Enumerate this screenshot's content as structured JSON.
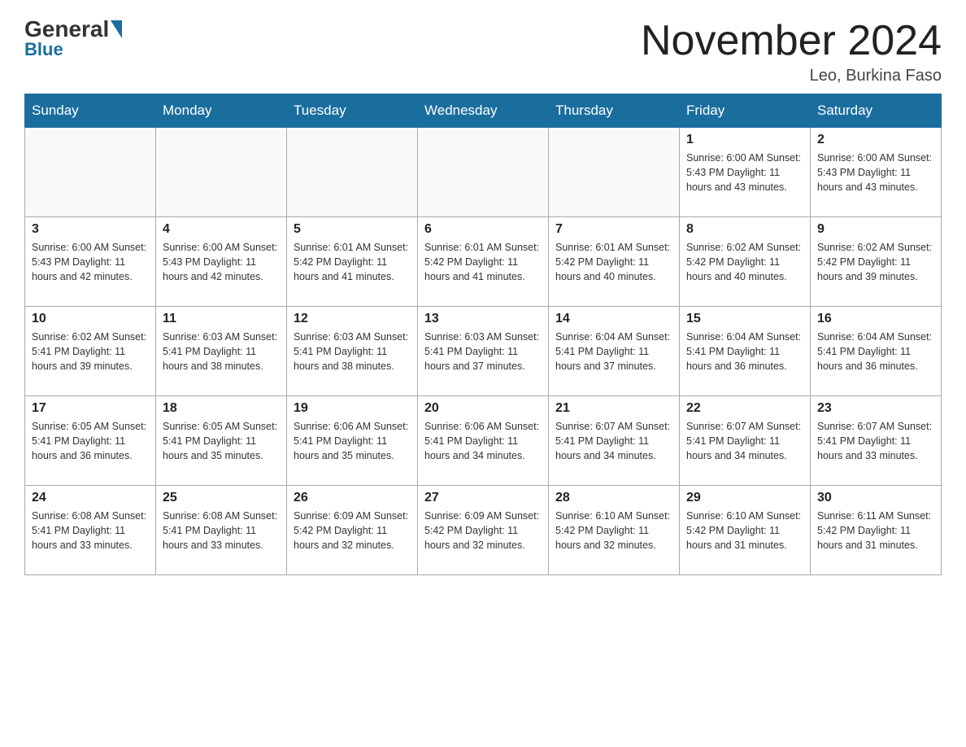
{
  "header": {
    "logo_general": "General",
    "logo_blue": "Blue",
    "month_title": "November 2024",
    "location": "Leo, Burkina Faso"
  },
  "days_of_week": [
    "Sunday",
    "Monday",
    "Tuesday",
    "Wednesday",
    "Thursday",
    "Friday",
    "Saturday"
  ],
  "weeks": [
    [
      {
        "day": "",
        "info": ""
      },
      {
        "day": "",
        "info": ""
      },
      {
        "day": "",
        "info": ""
      },
      {
        "day": "",
        "info": ""
      },
      {
        "day": "",
        "info": ""
      },
      {
        "day": "1",
        "info": "Sunrise: 6:00 AM\nSunset: 5:43 PM\nDaylight: 11 hours and 43 minutes."
      },
      {
        "day": "2",
        "info": "Sunrise: 6:00 AM\nSunset: 5:43 PM\nDaylight: 11 hours and 43 minutes."
      }
    ],
    [
      {
        "day": "3",
        "info": "Sunrise: 6:00 AM\nSunset: 5:43 PM\nDaylight: 11 hours and 42 minutes."
      },
      {
        "day": "4",
        "info": "Sunrise: 6:00 AM\nSunset: 5:43 PM\nDaylight: 11 hours and 42 minutes."
      },
      {
        "day": "5",
        "info": "Sunrise: 6:01 AM\nSunset: 5:42 PM\nDaylight: 11 hours and 41 minutes."
      },
      {
        "day": "6",
        "info": "Sunrise: 6:01 AM\nSunset: 5:42 PM\nDaylight: 11 hours and 41 minutes."
      },
      {
        "day": "7",
        "info": "Sunrise: 6:01 AM\nSunset: 5:42 PM\nDaylight: 11 hours and 40 minutes."
      },
      {
        "day": "8",
        "info": "Sunrise: 6:02 AM\nSunset: 5:42 PM\nDaylight: 11 hours and 40 minutes."
      },
      {
        "day": "9",
        "info": "Sunrise: 6:02 AM\nSunset: 5:42 PM\nDaylight: 11 hours and 39 minutes."
      }
    ],
    [
      {
        "day": "10",
        "info": "Sunrise: 6:02 AM\nSunset: 5:41 PM\nDaylight: 11 hours and 39 minutes."
      },
      {
        "day": "11",
        "info": "Sunrise: 6:03 AM\nSunset: 5:41 PM\nDaylight: 11 hours and 38 minutes."
      },
      {
        "day": "12",
        "info": "Sunrise: 6:03 AM\nSunset: 5:41 PM\nDaylight: 11 hours and 38 minutes."
      },
      {
        "day": "13",
        "info": "Sunrise: 6:03 AM\nSunset: 5:41 PM\nDaylight: 11 hours and 37 minutes."
      },
      {
        "day": "14",
        "info": "Sunrise: 6:04 AM\nSunset: 5:41 PM\nDaylight: 11 hours and 37 minutes."
      },
      {
        "day": "15",
        "info": "Sunrise: 6:04 AM\nSunset: 5:41 PM\nDaylight: 11 hours and 36 minutes."
      },
      {
        "day": "16",
        "info": "Sunrise: 6:04 AM\nSunset: 5:41 PM\nDaylight: 11 hours and 36 minutes."
      }
    ],
    [
      {
        "day": "17",
        "info": "Sunrise: 6:05 AM\nSunset: 5:41 PM\nDaylight: 11 hours and 36 minutes."
      },
      {
        "day": "18",
        "info": "Sunrise: 6:05 AM\nSunset: 5:41 PM\nDaylight: 11 hours and 35 minutes."
      },
      {
        "day": "19",
        "info": "Sunrise: 6:06 AM\nSunset: 5:41 PM\nDaylight: 11 hours and 35 minutes."
      },
      {
        "day": "20",
        "info": "Sunrise: 6:06 AM\nSunset: 5:41 PM\nDaylight: 11 hours and 34 minutes."
      },
      {
        "day": "21",
        "info": "Sunrise: 6:07 AM\nSunset: 5:41 PM\nDaylight: 11 hours and 34 minutes."
      },
      {
        "day": "22",
        "info": "Sunrise: 6:07 AM\nSunset: 5:41 PM\nDaylight: 11 hours and 34 minutes."
      },
      {
        "day": "23",
        "info": "Sunrise: 6:07 AM\nSunset: 5:41 PM\nDaylight: 11 hours and 33 minutes."
      }
    ],
    [
      {
        "day": "24",
        "info": "Sunrise: 6:08 AM\nSunset: 5:41 PM\nDaylight: 11 hours and 33 minutes."
      },
      {
        "day": "25",
        "info": "Sunrise: 6:08 AM\nSunset: 5:41 PM\nDaylight: 11 hours and 33 minutes."
      },
      {
        "day": "26",
        "info": "Sunrise: 6:09 AM\nSunset: 5:42 PM\nDaylight: 11 hours and 32 minutes."
      },
      {
        "day": "27",
        "info": "Sunrise: 6:09 AM\nSunset: 5:42 PM\nDaylight: 11 hours and 32 minutes."
      },
      {
        "day": "28",
        "info": "Sunrise: 6:10 AM\nSunset: 5:42 PM\nDaylight: 11 hours and 32 minutes."
      },
      {
        "day": "29",
        "info": "Sunrise: 6:10 AM\nSunset: 5:42 PM\nDaylight: 11 hours and 31 minutes."
      },
      {
        "day": "30",
        "info": "Sunrise: 6:11 AM\nSunset: 5:42 PM\nDaylight: 11 hours and 31 minutes."
      }
    ]
  ]
}
